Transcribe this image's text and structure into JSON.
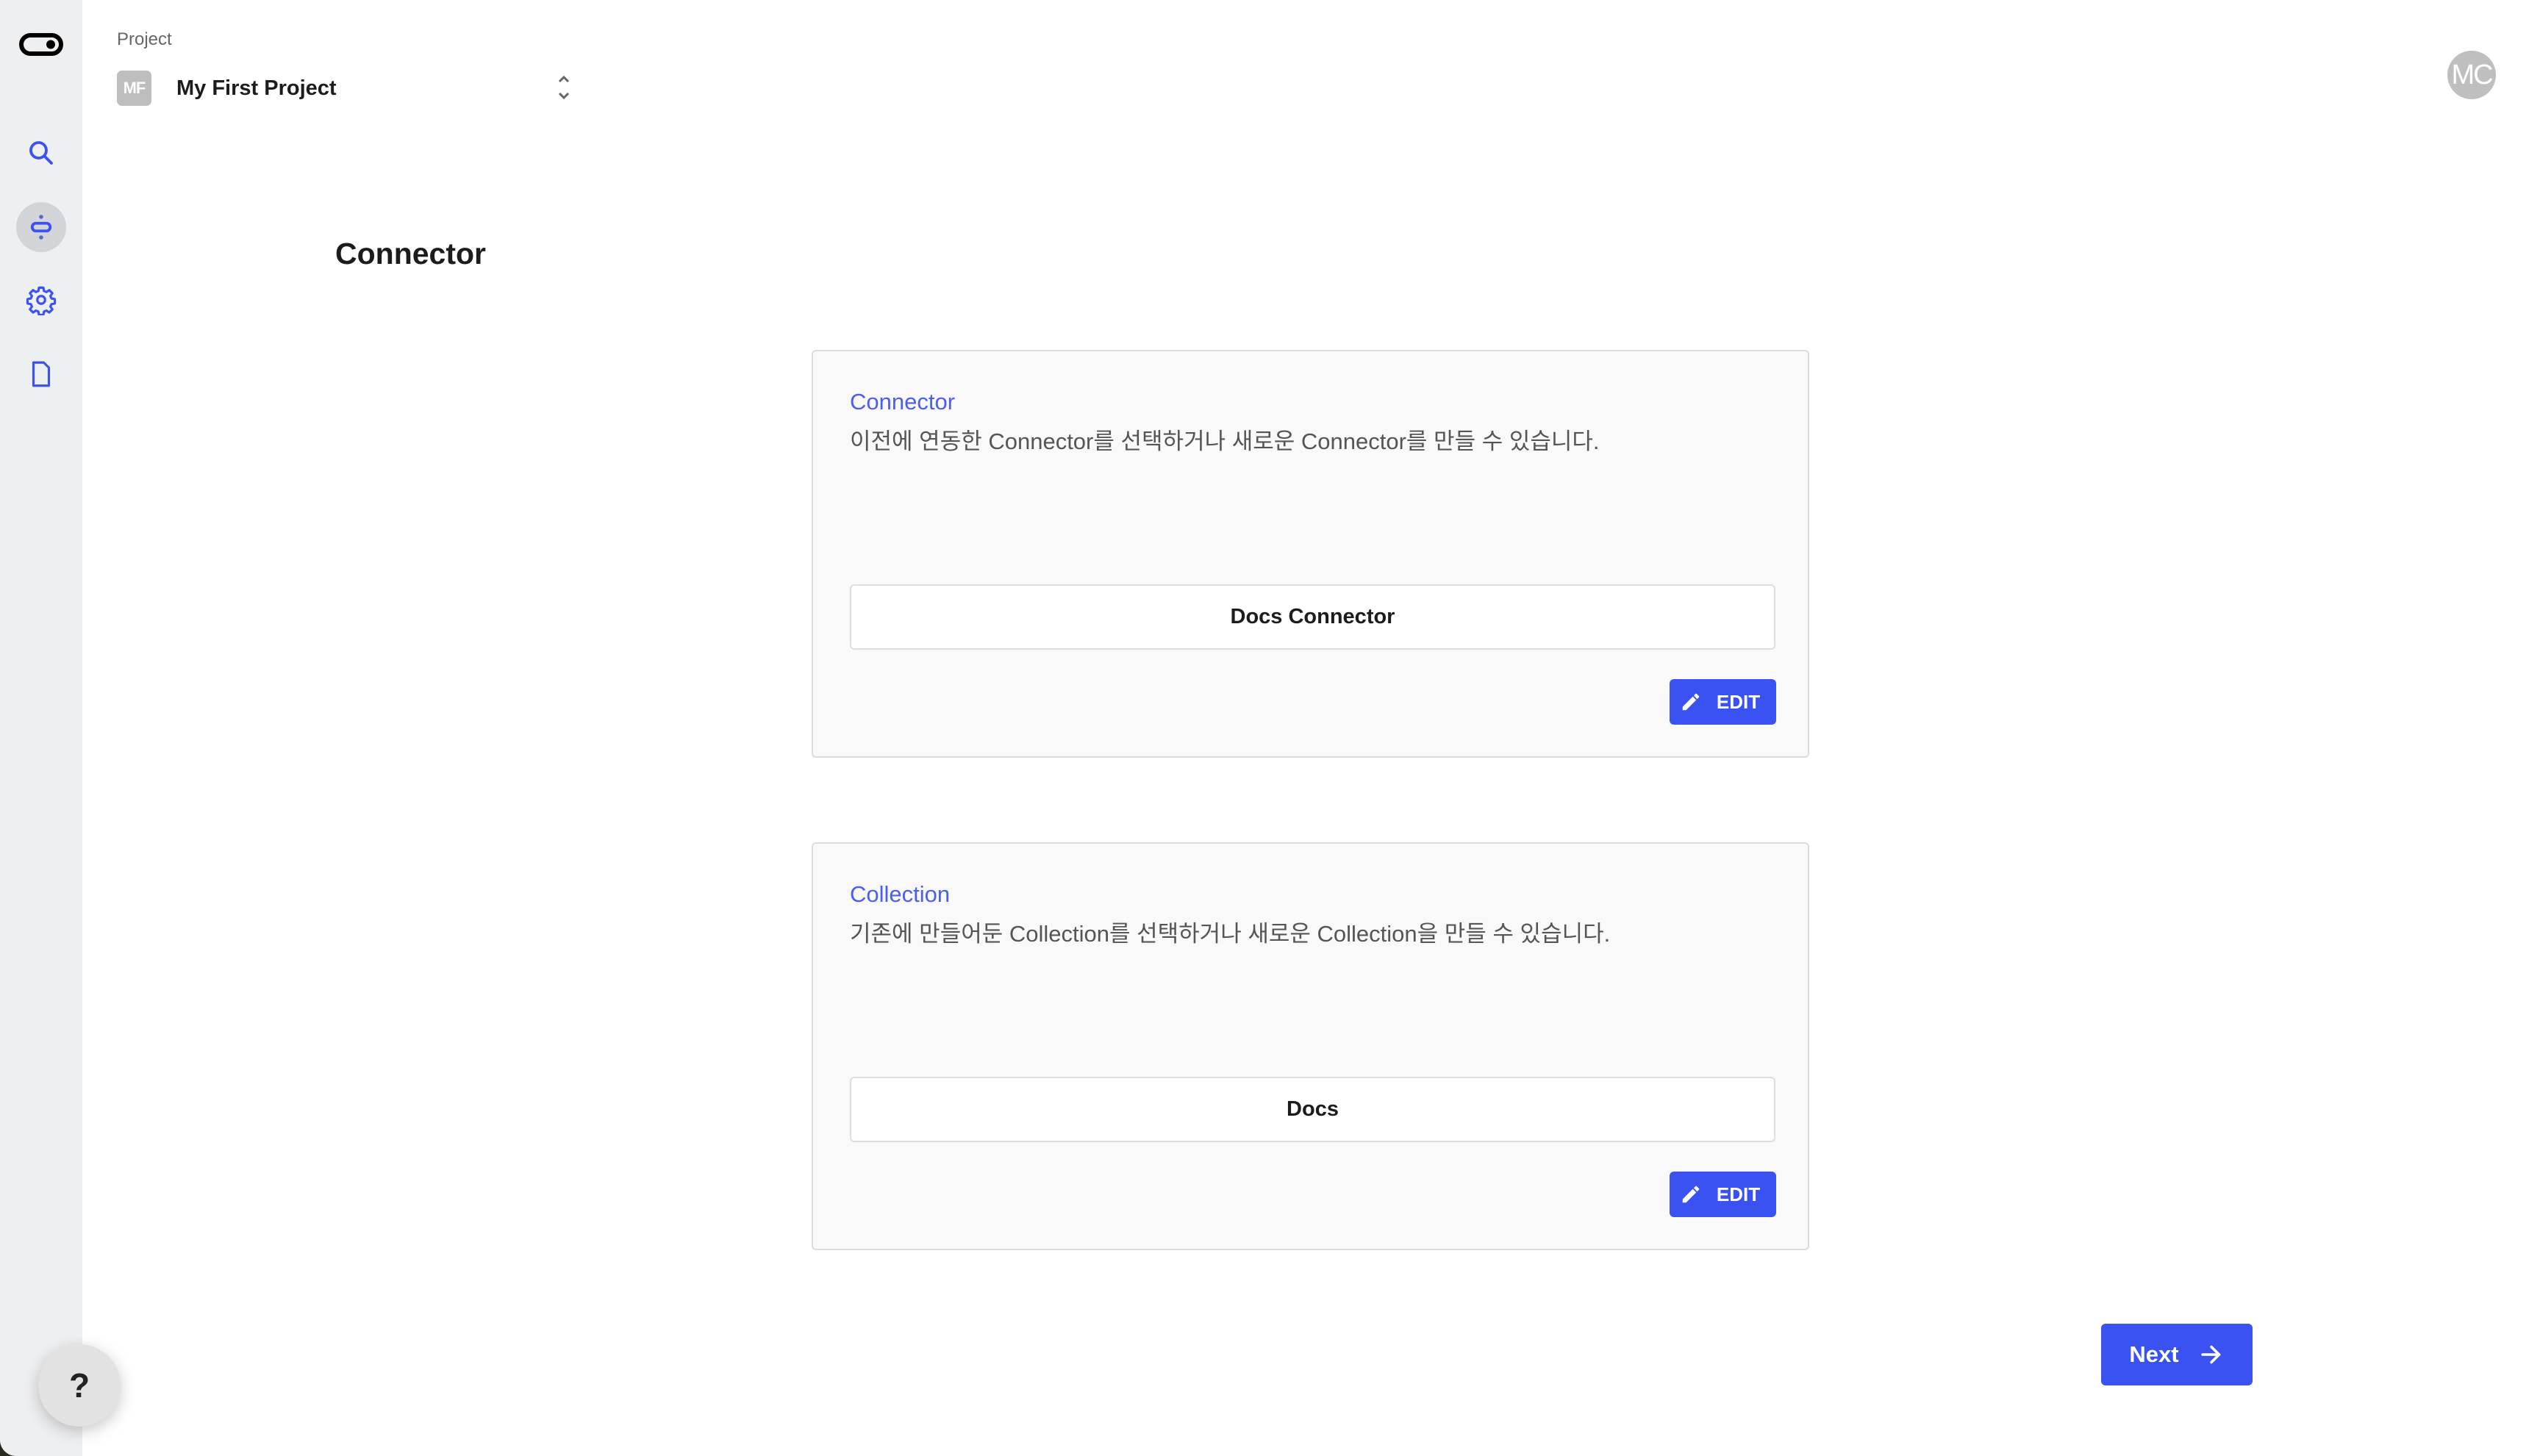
{
  "header": {
    "project_label": "Project",
    "project_badge": "MF",
    "project_name": "My First Project",
    "user_initials": "MC"
  },
  "sidebar": {
    "items": [
      {
        "name": "search",
        "icon": "search-icon",
        "active": false
      },
      {
        "name": "connector",
        "icon": "connector-icon",
        "active": true
      },
      {
        "name": "settings",
        "icon": "gear-icon",
        "active": false
      },
      {
        "name": "documents",
        "icon": "document-icon",
        "active": false
      }
    ],
    "help_label": "?"
  },
  "main": {
    "title": "Connector",
    "cards": [
      {
        "label": "Connector",
        "description": "이전에 연동한 Connector를 선택하거나 새로운 Connector를 만들 수 있습니다.",
        "value": "Docs Connector",
        "edit_label": "EDIT"
      },
      {
        "label": "Collection",
        "description": "기존에 만들어둔 Collection를 선택하거나 새로운 Collection을 만들 수 있습니다.",
        "value": "Docs",
        "edit_label": "EDIT"
      }
    ],
    "next_label": "Next"
  },
  "colors": {
    "accent": "#3a52f2",
    "label_blue": "#4b5ef2",
    "sidebar_bg": "#eeeff1",
    "card_bg": "#f9f9f9"
  }
}
